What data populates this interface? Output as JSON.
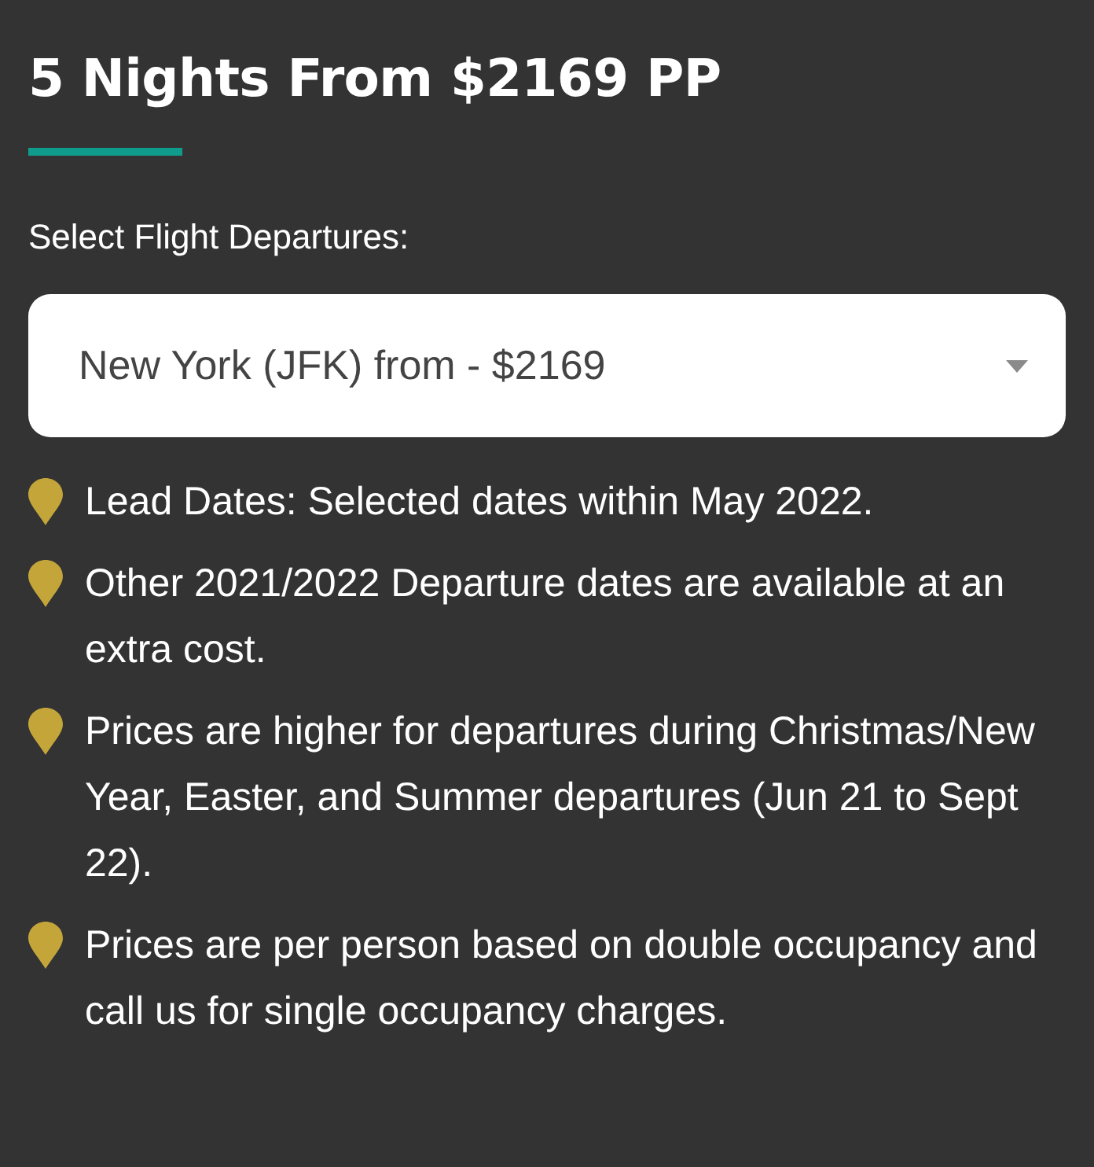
{
  "title": "5 Nights From $2169 PP",
  "select_label": "Select Flight Departures:",
  "select": {
    "value": "New York (JFK) from - $2169"
  },
  "notes": [
    "Lead Dates: Selected dates within May 2022.",
    "Other 2021/2022 Departure dates are available at an extra cost.",
    "Prices are higher for departures during Christmas/New Year, Easter, and Summer departures (Jun 21 to Sept 22).",
    "Prices are per person based on double occupancy and call us for single occupancy charges."
  ]
}
